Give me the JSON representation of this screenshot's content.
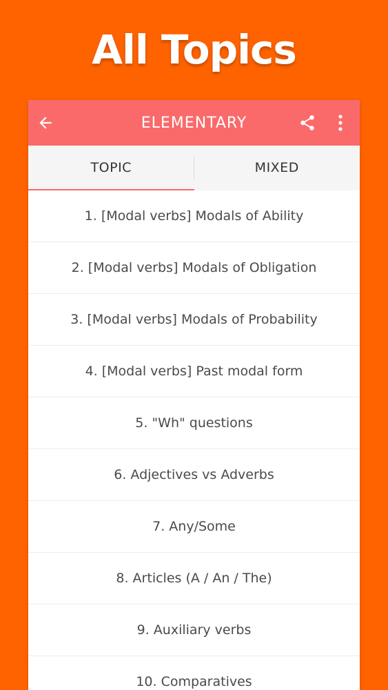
{
  "promo": {
    "title": "All Topics"
  },
  "appbar": {
    "title": "ELEMENTARY",
    "back_icon": "arrow-left-icon",
    "share_icon": "share-icon",
    "more_icon": "more-vertical-icon",
    "color": "#FA6A6A"
  },
  "tabs": [
    {
      "label": "TOPIC",
      "active": true
    },
    {
      "label": "MIXED",
      "active": false
    }
  ],
  "topics": [
    "1. [Modal verbs] Modals of Ability",
    "2. [Modal verbs] Modals of Obligation",
    "3. [Modal verbs] Modals of Probability",
    "4. [Modal verbs] Past modal form",
    "5. \"Wh\" questions",
    "6. Adjectives vs Adverbs",
    "7. Any/Some",
    "8. Articles (A / An / The)",
    "9. Auxiliary verbs",
    "10. Comparatives"
  ],
  "colors": {
    "background": "#FF6300",
    "accent": "#FA6A6A"
  }
}
